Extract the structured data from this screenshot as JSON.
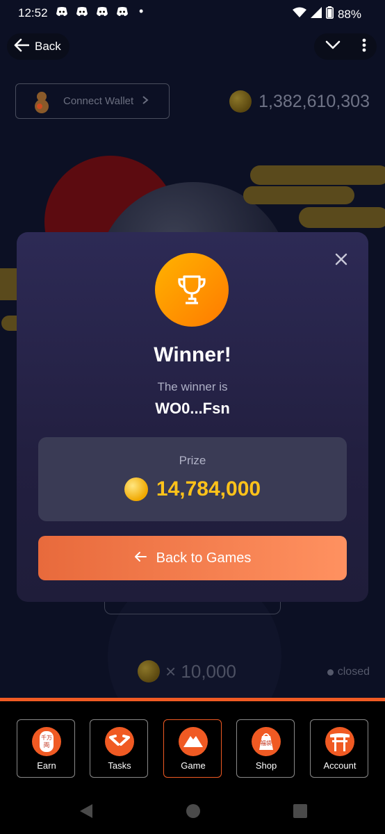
{
  "status_bar": {
    "time": "12:52",
    "battery": "88%"
  },
  "header": {
    "back_label": "Back"
  },
  "scene": {
    "wallet_label": "Connect Wallet",
    "balance": "1,382,610,303",
    "multiplier": "× 10,000",
    "status": "closed"
  },
  "modal": {
    "title": "Winner!",
    "subtitle": "The winner is",
    "winner_address": "WO0...Fsn",
    "prize_label": "Prize",
    "prize_value": "14,784,000",
    "back_button_label": "Back to Games"
  },
  "nav": {
    "items": [
      {
        "label": "Earn",
        "icon": "earn-icon"
      },
      {
        "label": "Tasks",
        "icon": "tasks-icon"
      },
      {
        "label": "Game",
        "icon": "game-icon"
      },
      {
        "label": "Shop",
        "icon": "shop-icon"
      },
      {
        "label": "Account",
        "icon": "account-icon"
      }
    ],
    "active_index": 2
  },
  "colors": {
    "accent": "#f05a23",
    "prize": "#ffc21a",
    "modal_bg": "#2d2a55"
  }
}
